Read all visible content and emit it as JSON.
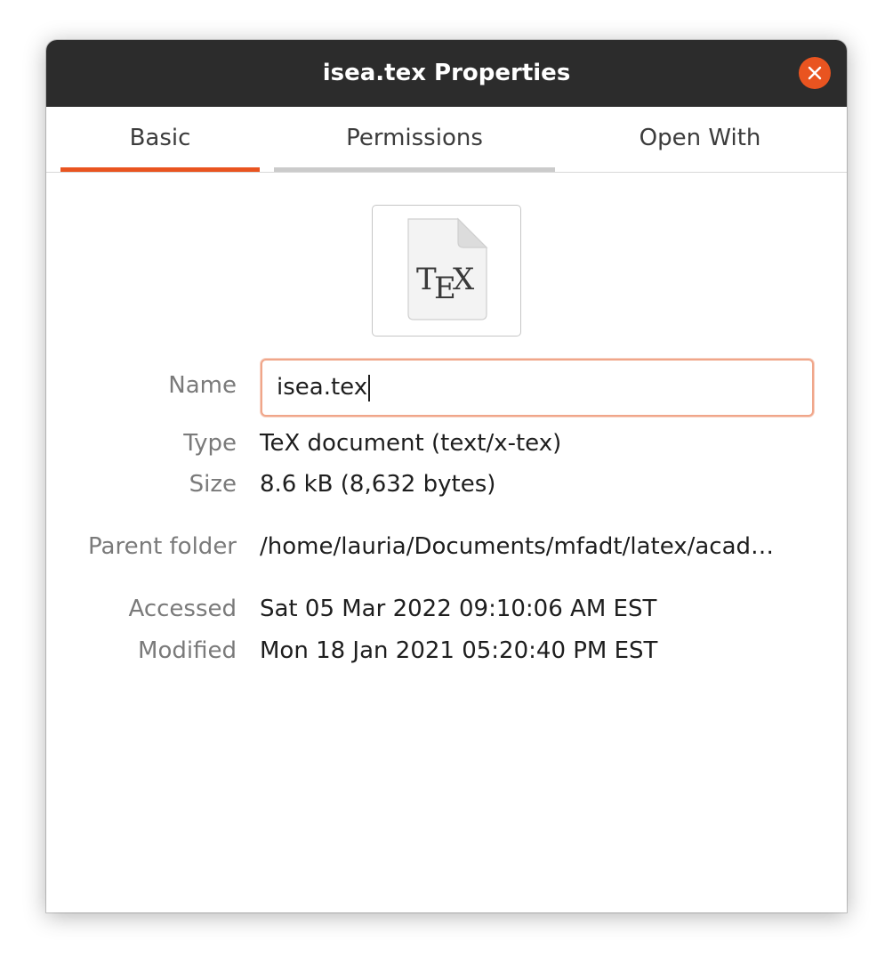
{
  "window": {
    "title": "isea.tex Properties"
  },
  "tabs": [
    {
      "label": "Basic",
      "active": true
    },
    {
      "label": "Permissions",
      "active": false
    },
    {
      "label": "Open With",
      "active": false
    }
  ],
  "file_icon": {
    "name": "tex-file-icon",
    "glyph": "TEX"
  },
  "properties": {
    "name_label": "Name",
    "name_value": "isea.tex",
    "type_label": "Type",
    "type_value": "TeX document (text/x-tex)",
    "size_label": "Size",
    "size_value": "8.6 kB (8,632 bytes)",
    "parent_label": "Parent folder",
    "parent_value": "/home/lauria/Documents/mfadt/latex/acad…",
    "accessed_label": "Accessed",
    "accessed_value": "Sat 05 Mar 2022 09:10:06 AM EST",
    "modified_label": "Modified",
    "modified_value": "Mon 18 Jan 2021 05:20:40 PM EST"
  },
  "colors": {
    "accent": "#e95420",
    "titlebar": "#2c2c2c",
    "focus_border": "#f0a68a"
  }
}
